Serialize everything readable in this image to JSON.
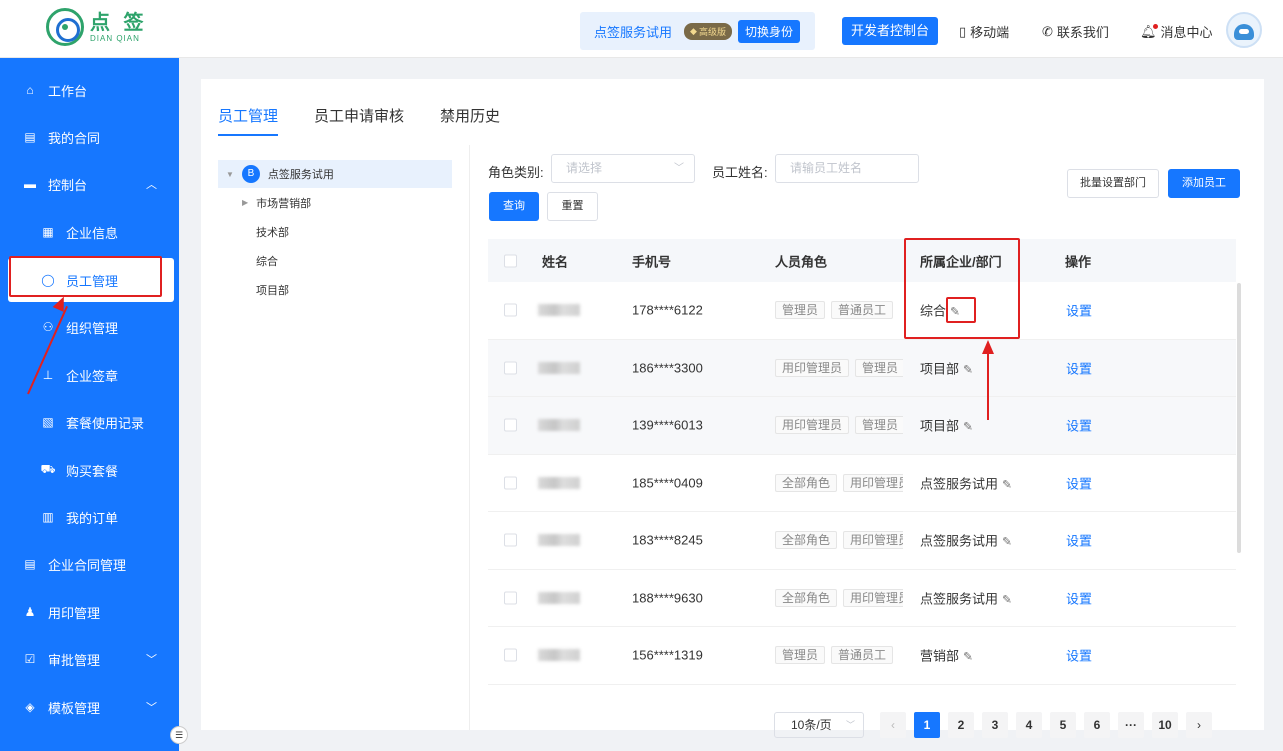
{
  "header": {
    "logo_cn": "点 签",
    "logo_en": "DIAN QIAN",
    "identity_name": "点签服务试用",
    "identity_badge": "高级版",
    "switch_identity": "切换身份",
    "developer_console": "开发者控制台",
    "mobile": "移动端",
    "contact": "联系我们",
    "messages": "消息中心"
  },
  "sidebar": {
    "items": [
      {
        "label": "工作台",
        "icon": "home-icon"
      },
      {
        "label": "我的合同",
        "icon": "contract-icon"
      },
      {
        "label": "控制台",
        "icon": "console-icon"
      },
      {
        "label": "企业信息",
        "icon": "building-icon"
      },
      {
        "label": "员工管理",
        "icon": "user-icon"
      },
      {
        "label": "组织管理",
        "icon": "org-icon"
      },
      {
        "label": "企业签章",
        "icon": "seal-icon"
      },
      {
        "label": "套餐使用记录",
        "icon": "record-icon"
      },
      {
        "label": "购买套餐",
        "icon": "cart-icon"
      },
      {
        "label": "我的订单",
        "icon": "order-icon"
      },
      {
        "label": "企业合同管理",
        "icon": "doc-icon"
      },
      {
        "label": "用印管理",
        "icon": "stamp-icon"
      },
      {
        "label": "审批管理",
        "icon": "approve-icon"
      },
      {
        "label": "模板管理",
        "icon": "template-icon"
      }
    ]
  },
  "tabs": [
    {
      "label": "员工管理"
    },
    {
      "label": "员工申请审核"
    },
    {
      "label": "禁用历史"
    }
  ],
  "tree": {
    "root": "点签服务试用",
    "nodes": [
      "市场营销部",
      "技术部",
      "综合",
      "项目部"
    ]
  },
  "filters": {
    "role_label": "角色类别:",
    "role_placeholder": "请选择",
    "name_label": "员工姓名:",
    "name_placeholder": "请输员工姓名",
    "search": "查询",
    "reset": "重置",
    "batch_dept": "批量设置部门",
    "add_employee": "添加员工"
  },
  "table": {
    "columns": [
      "姓名",
      "手机号",
      "人员角色",
      "所属企业/部门",
      "操作"
    ],
    "rows": [
      {
        "phone": "178****6122",
        "roles": [
          "管理员",
          "普通员工"
        ],
        "dept": "综合",
        "action": "设置"
      },
      {
        "phone": "186****3300",
        "roles": [
          "用印管理员",
          "管理员"
        ],
        "dept": "项目部",
        "action": "设置"
      },
      {
        "phone": "139****6013",
        "roles": [
          "用印管理员",
          "管理员"
        ],
        "dept": "项目部",
        "action": "设置"
      },
      {
        "phone": "185****0409",
        "roles": [
          "全部角色",
          "用印管理员"
        ],
        "dept": "点签服务试用",
        "action": "设置"
      },
      {
        "phone": "183****8245",
        "roles": [
          "全部角色",
          "用印管理员"
        ],
        "dept": "点签服务试用",
        "action": "设置"
      },
      {
        "phone": "188****9630",
        "roles": [
          "全部角色",
          "用印管理员"
        ],
        "dept": "点签服务试用",
        "action": "设置"
      },
      {
        "phone": "156****1319",
        "roles": [
          "管理员",
          "普通员工"
        ],
        "dept": "营销部",
        "action": "设置"
      }
    ]
  },
  "pagination": {
    "page_size": "10条/页",
    "pages": [
      "1",
      "2",
      "3",
      "4",
      "5",
      "6",
      "···",
      "10"
    ],
    "current": "1"
  },
  "colors": {
    "primary": "#1677ff",
    "annotation": "#e02020",
    "brand_green": "#2ea36b"
  }
}
